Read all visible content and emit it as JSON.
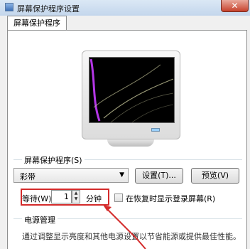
{
  "window": {
    "title": "屏幕保护程序设置",
    "close_glyph": "✕"
  },
  "tabs": [
    {
      "label": "屏幕保护程序"
    }
  ],
  "screensaver": {
    "group_label": "屏幕保护程序(S)",
    "selected": "彩带",
    "settings_button": "设置(T)...",
    "preview_button": "预览(V)"
  },
  "wait": {
    "label": "等待(W):",
    "value": "1",
    "unit": "分钟"
  },
  "resume": {
    "label": "在恢复时显示登录屏幕(R)",
    "checked": false
  },
  "power": {
    "title": "电源管理",
    "description": "通过调整显示亮度和其他电源设置以节省能源或提供最佳性能。"
  },
  "colors": {
    "highlight": "#d42b2b",
    "ribbon_magenta": "#c83cff",
    "ribbon_pale": "#d8d8a8"
  },
  "icons": {
    "app": "window-icon",
    "close": "close-icon",
    "dropdown": "chevron-down-icon",
    "spin_up": "caret-up-icon",
    "spin_down": "caret-down-icon"
  }
}
